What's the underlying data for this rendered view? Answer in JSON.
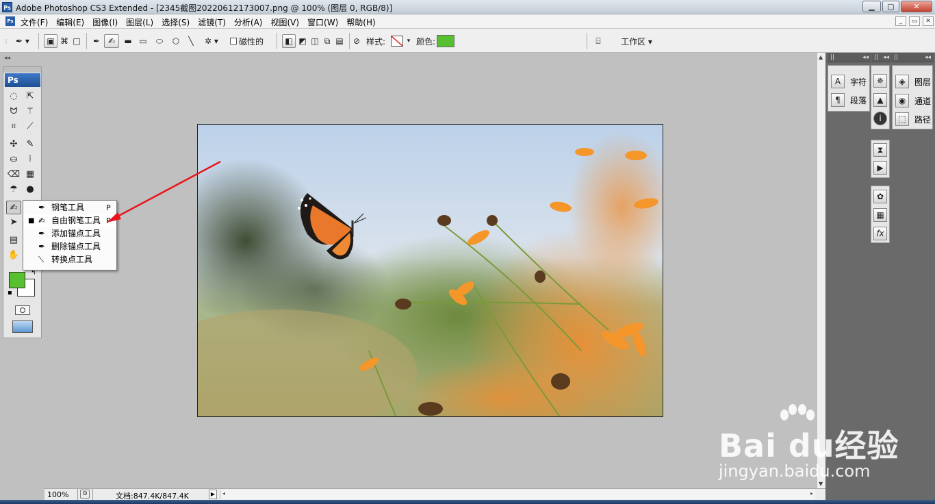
{
  "title_bar": {
    "app_icon": "Ps",
    "title": "Adobe Photoshop CS3 Extended - [2345截图20220612173007.png @ 100% (图层 0, RGB/8)]",
    "minimize": "▁",
    "maximize": "▢",
    "close": "✕"
  },
  "menu_bar": {
    "app_icon": "Ps",
    "items": [
      "文件(F)",
      "编辑(E)",
      "图像(I)",
      "图层(L)",
      "选择(S)",
      "滤镜(T)",
      "分析(A)",
      "视图(V)",
      "窗口(W)",
      "帮助(H)"
    ],
    "doc_minimize": "_",
    "doc_restore": "▭",
    "doc_close": "✕"
  },
  "options_bar": {
    "magnetic_label": "磁性的",
    "style_label": "样式:",
    "color_label": "颜色:",
    "color_value": "#58c030",
    "workspace_label": "工作区 ▾"
  },
  "toolbox": {
    "logo": "Ps",
    "foreground_color": "#58c030",
    "background_color": "#ffffff"
  },
  "pen_flyout": {
    "items": [
      {
        "label": "钢笔工具",
        "key": "P",
        "selected": "",
        "icon": "pen-icon"
      },
      {
        "label": "自由钢笔工具",
        "key": "P",
        "selected": "■",
        "icon": "freeform-pen-icon"
      },
      {
        "label": "添加锚点工具",
        "key": "",
        "selected": "",
        "icon": "add-anchor-icon"
      },
      {
        "label": "删除锚点工具",
        "key": "",
        "selected": "",
        "icon": "delete-anchor-icon"
      },
      {
        "label": "转换点工具",
        "key": "",
        "selected": "",
        "icon": "convert-point-icon"
      }
    ]
  },
  "status_bar": {
    "zoom": "100%",
    "doc_info": "文档:847.4K/847.4K"
  },
  "panels": {
    "character": "字符",
    "paragraph": "段落",
    "layers": "图层",
    "channels": "通道",
    "paths": "路径"
  },
  "watermark": {
    "brand": "Bai du经验",
    "url": "jingyan.baidu.com"
  }
}
